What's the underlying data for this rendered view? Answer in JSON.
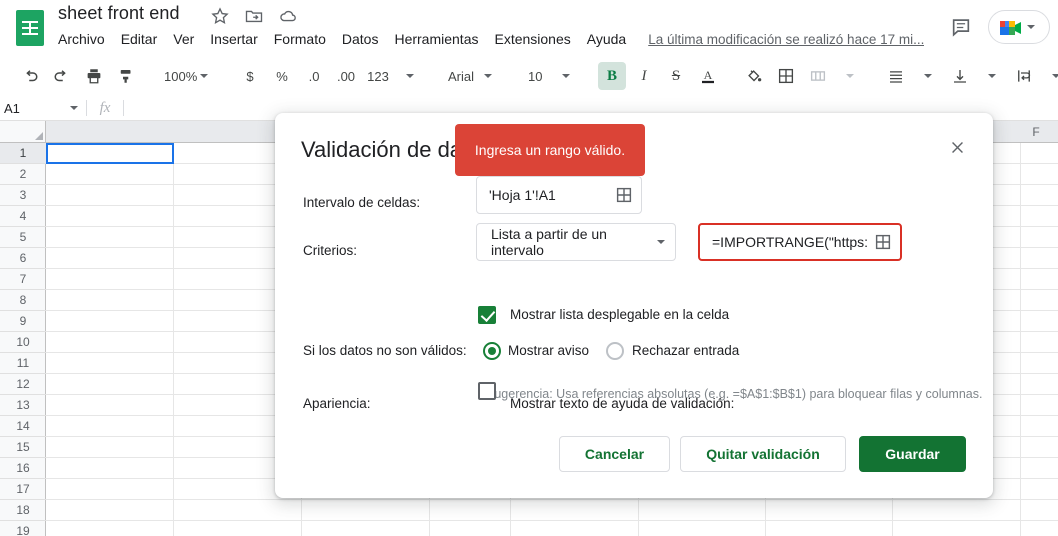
{
  "app": {
    "doc_title": "sheet front end",
    "title_icons": [
      "star-icon",
      "move-to-folder-icon",
      "cloud-saved-icon"
    ],
    "menu": [
      "Archivo",
      "Editar",
      "Ver",
      "Insertar",
      "Formato",
      "Datos",
      "Herramientas",
      "Extensiones",
      "Ayuda"
    ],
    "last_edit": "La última modificación se realizó hace 17 mi...",
    "comment_icon": "comment-icon",
    "meet_icon": "google-meet-icon"
  },
  "toolbar": {
    "zoom": "100%",
    "font": "Arial",
    "font_size": "10",
    "currency": "$",
    "percent": "%",
    "decrease_decimal": ".0",
    "increase_decimal": ".00",
    "number_format": "123",
    "bold": "B",
    "italic": "I",
    "strikethrough": "S",
    "text_color": "A"
  },
  "formula_bar": {
    "name_box": "A1",
    "fx": "fx",
    "formula_value": ""
  },
  "grid": {
    "columns": [
      "F"
    ],
    "rows": [
      "1",
      "2",
      "3",
      "4",
      "5",
      "6",
      "7",
      "8",
      "9",
      "10",
      "11",
      "12",
      "13",
      "14",
      "15",
      "16",
      "17",
      "18",
      "19"
    ],
    "selected_cell": "A1"
  },
  "dialog": {
    "title": "Validación de datos",
    "close_label": "×",
    "error_tooltip": "Ingresa un rango válido.",
    "cell_range_label": "Intervalo de celdas:",
    "cell_range_value": "'Hoja 1'!A1",
    "criteria_label": "Criterios:",
    "criteria_type": "Lista a partir de un intervalo",
    "criteria_value": "=IMPORTRANGE(\"https:/",
    "hint": "Sugerencia: Usa referencias absolutas (e.g. =$A$1:$B$1) para bloquear filas y columnas.",
    "show_dropdown_label": "Mostrar lista desplegable en la celda",
    "show_dropdown_checked": true,
    "invalid_data_label": "Si los datos no son válidos:",
    "option_warning": "Mostrar aviso",
    "option_reject": "Rechazar entrada",
    "selected_invalid_option": "Mostrar aviso",
    "appearance_label": "Apariencia:",
    "help_text_label": "Mostrar texto de ayuda de validación:",
    "help_text_checked": false,
    "cancel_label": "Cancelar",
    "remove_label": "Quitar validación",
    "save_label": "Guardar"
  },
  "colors": {
    "brand_green": "#188038",
    "error_red": "#db4437",
    "error_border": "#d93025",
    "selection_blue": "#1a73e8"
  }
}
